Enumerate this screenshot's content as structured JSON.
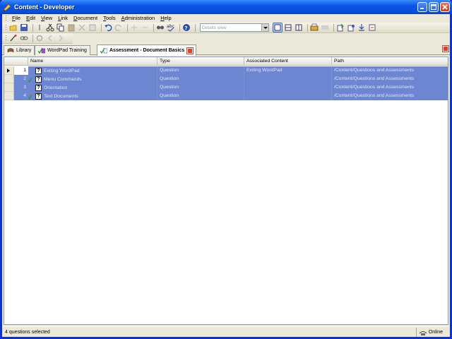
{
  "window": {
    "title": "Content - Developer"
  },
  "menu": [
    {
      "label": "File",
      "key": "F"
    },
    {
      "label": "Edit",
      "key": "E"
    },
    {
      "label": "View",
      "key": "V"
    },
    {
      "label": "Link",
      "key": "L"
    },
    {
      "label": "Document",
      "key": "D"
    },
    {
      "label": "Tools",
      "key": "T"
    },
    {
      "label": "Administration",
      "key": "A"
    },
    {
      "label": "Help",
      "key": "H"
    }
  ],
  "toolbar": {
    "view_select": "Details view"
  },
  "tabs": [
    {
      "label": "Library"
    },
    {
      "label": "WordPad Training"
    },
    {
      "label": "Assessment - Document Basics"
    }
  ],
  "grid": {
    "columns": [
      "Name",
      "Type",
      "Associated Content",
      "Path"
    ],
    "rows": [
      {
        "num": "1",
        "name": "Exiting WordPad",
        "type": "Question",
        "assoc": "Exiting WordPad",
        "path": "/Content/Questions and Assessments"
      },
      {
        "num": "2",
        "name": "Menu Commands",
        "type": "Question",
        "assoc": "",
        "path": "/Content/Questions and Assessments"
      },
      {
        "num": "3",
        "name": "Orientation",
        "type": "Question",
        "assoc": "",
        "path": "/Content/Questions and Assessments"
      },
      {
        "num": "4",
        "name": "Text Documents",
        "type": "Question",
        "assoc": "",
        "path": "/Content/Questions and Assessments"
      }
    ]
  },
  "status": {
    "left": "4 questions selected",
    "right": "Online"
  },
  "colors": {
    "titlebar": "#0a4fd8",
    "selection": "#6d86d2",
    "chrome": "#ece9d8"
  }
}
